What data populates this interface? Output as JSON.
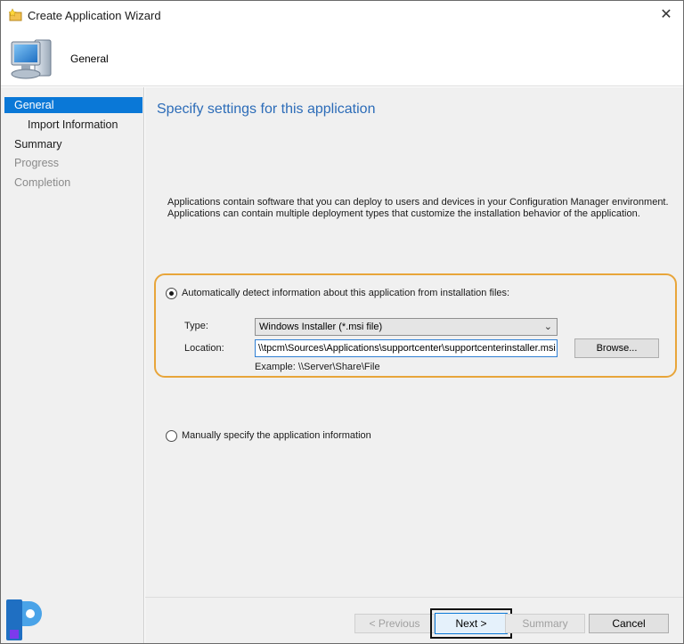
{
  "window": {
    "title": "Create Application Wizard",
    "close_glyph": "✕"
  },
  "header": {
    "title": "General",
    "icon": "computer-icon"
  },
  "sidebar": {
    "items": [
      {
        "label": "General",
        "state": "active"
      },
      {
        "label": "Import Information",
        "state": "normal"
      },
      {
        "label": "Summary",
        "state": "normal"
      },
      {
        "label": "Progress",
        "state": "disabled"
      },
      {
        "label": "Completion",
        "state": "disabled"
      }
    ]
  },
  "main": {
    "heading": "Specify settings for this application",
    "description_line1": "Applications contain software that you can deploy to users and devices in your Configuration Manager environment.",
    "description_line2": "Applications can contain multiple deployment types that customize the installation behavior of the application.",
    "auto_detect": {
      "label": "Automatically detect information about this application from installation files:",
      "selected": true
    },
    "type_label": "Type:",
    "type_value": "Windows Installer (*.msi file)",
    "location_label": "Location:",
    "location_value": "\\\\tpcm\\Sources\\Applications\\supportcenter\\supportcenterinstaller.msi",
    "browse_label": "Browse...",
    "example_text": "Example: \\\\Server\\Share\\File",
    "manual": {
      "label": "Manually specify the application information",
      "selected": false
    }
  },
  "footer": {
    "previous_label": "< Previous",
    "next_label": "Next >",
    "summary_label": "Summary",
    "cancel_label": "Cancel"
  },
  "colors": {
    "accent": "#0a78d7",
    "heading": "#2c6cb8",
    "highlight": "#e8a53a"
  }
}
